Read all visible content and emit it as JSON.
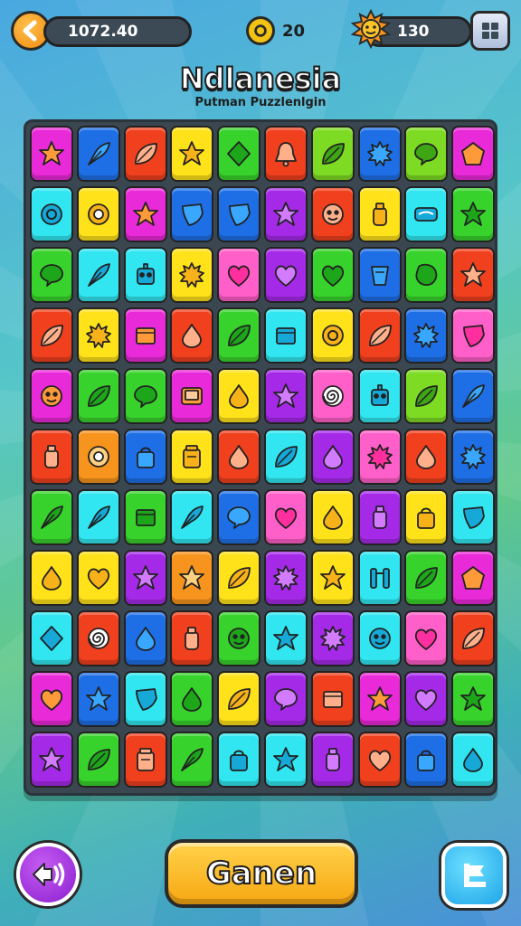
{
  "header": {
    "coins": "1072.40",
    "timer": "20",
    "gems": "130"
  },
  "title": "Ndlanesia",
  "subtitle": "Putman Puzzlenlgin",
  "main_button_label": "Ganen",
  "colors": {
    "red": "#f0401e",
    "orange": "#f7941d",
    "yellow": "#ffe21a",
    "green": "#38d22c",
    "lime": "#7edb24",
    "cyan": "#31e6f0",
    "blue": "#1e6fe6",
    "purple": "#a52ae8",
    "magenta": "#e92ad8",
    "pink": "#ff5fc8",
    "board": "#3b4750"
  },
  "grid": [
    [
      [
        "magenta",
        "star"
      ],
      [
        "blue",
        "feather"
      ],
      [
        "red",
        "leaf"
      ],
      [
        "yellow",
        "star"
      ],
      [
        "green",
        "diamond"
      ],
      [
        "red",
        "bell"
      ],
      [
        "lime",
        "leaf"
      ],
      [
        "blue",
        "spiky"
      ],
      [
        "lime",
        "speech"
      ],
      [
        "magenta",
        "pentagon"
      ]
    ],
    [
      [
        "cyan",
        "ring"
      ],
      [
        "yellow",
        "gear"
      ],
      [
        "magenta",
        "star"
      ],
      [
        "blue",
        "shield"
      ],
      [
        "blue",
        "shield"
      ],
      [
        "purple",
        "star"
      ],
      [
        "red",
        "face"
      ],
      [
        "yellow",
        "bottle"
      ],
      [
        "cyan",
        "tube"
      ],
      [
        "green",
        "star"
      ]
    ],
    [
      [
        "green",
        "speech"
      ],
      [
        "cyan",
        "feather"
      ],
      [
        "cyan",
        "robot"
      ],
      [
        "yellow",
        "spiky"
      ],
      [
        "pink",
        "heart"
      ],
      [
        "purple",
        "heart"
      ],
      [
        "green",
        "heart"
      ],
      [
        "blue",
        "cup"
      ],
      [
        "green",
        "blob"
      ],
      [
        "red",
        "star"
      ]
    ],
    [
      [
        "red",
        "leaf"
      ],
      [
        "yellow",
        "spiky"
      ],
      [
        "magenta",
        "box"
      ],
      [
        "red",
        "drop"
      ],
      [
        "green",
        "leaf"
      ],
      [
        "cyan",
        "box"
      ],
      [
        "yellow",
        "ring"
      ],
      [
        "red",
        "leaf"
      ],
      [
        "blue",
        "spiky"
      ],
      [
        "pink",
        "shield"
      ]
    ],
    [
      [
        "magenta",
        "face"
      ],
      [
        "green",
        "leaf"
      ],
      [
        "green",
        "speech"
      ],
      [
        "magenta",
        "tv"
      ],
      [
        "yellow",
        "drop"
      ],
      [
        "purple",
        "star"
      ],
      [
        "pink",
        "spiral"
      ],
      [
        "cyan",
        "robot"
      ],
      [
        "lime",
        "leaf"
      ],
      [
        "blue",
        "feather"
      ]
    ],
    [
      [
        "red",
        "bottle"
      ],
      [
        "orange",
        "gear"
      ],
      [
        "blue",
        "bag"
      ],
      [
        "yellow",
        "jar"
      ],
      [
        "red",
        "drop"
      ],
      [
        "cyan",
        "leaf"
      ],
      [
        "purple",
        "drop"
      ],
      [
        "pink",
        "spiky"
      ],
      [
        "red",
        "drop"
      ],
      [
        "blue",
        "spiky"
      ]
    ],
    [
      [
        "green",
        "feather"
      ],
      [
        "cyan",
        "feather"
      ],
      [
        "green",
        "box"
      ],
      [
        "cyan",
        "feather"
      ],
      [
        "blue",
        "speech"
      ],
      [
        "pink",
        "heart"
      ],
      [
        "yellow",
        "drop"
      ],
      [
        "purple",
        "bottle"
      ],
      [
        "yellow",
        "bag"
      ],
      [
        "cyan",
        "shield"
      ]
    ],
    [
      [
        "yellow",
        "drop"
      ],
      [
        "yellow",
        "heart"
      ],
      [
        "purple",
        "star"
      ],
      [
        "orange",
        "star"
      ],
      [
        "yellow",
        "leaf"
      ],
      [
        "purple",
        "spiky"
      ],
      [
        "yellow",
        "star"
      ],
      [
        "cyan",
        "pillars"
      ],
      [
        "green",
        "leaf"
      ],
      [
        "magenta",
        "pentagon"
      ]
    ],
    [
      [
        "cyan",
        "diamond"
      ],
      [
        "red",
        "spiral"
      ],
      [
        "blue",
        "drop"
      ],
      [
        "red",
        "bottle"
      ],
      [
        "green",
        "face"
      ],
      [
        "cyan",
        "star"
      ],
      [
        "purple",
        "spiky"
      ],
      [
        "cyan",
        "face"
      ],
      [
        "pink",
        "heart"
      ],
      [
        "red",
        "leaf"
      ]
    ],
    [
      [
        "magenta",
        "heart"
      ],
      [
        "blue",
        "star"
      ],
      [
        "cyan",
        "shield"
      ],
      [
        "green",
        "drop"
      ],
      [
        "yellow",
        "leaf"
      ],
      [
        "purple",
        "speech"
      ],
      [
        "red",
        "box"
      ],
      [
        "magenta",
        "star"
      ],
      [
        "purple",
        "heart"
      ],
      [
        "green",
        "star"
      ]
    ],
    [
      [
        "purple",
        "star"
      ],
      [
        "green",
        "leaf"
      ],
      [
        "red",
        "jar"
      ],
      [
        "green",
        "feather"
      ],
      [
        "cyan",
        "bag"
      ],
      [
        "cyan",
        "star"
      ],
      [
        "purple",
        "bottle"
      ],
      [
        "red",
        "heart"
      ],
      [
        "blue",
        "bag"
      ],
      [
        "cyan",
        "drop"
      ]
    ]
  ]
}
